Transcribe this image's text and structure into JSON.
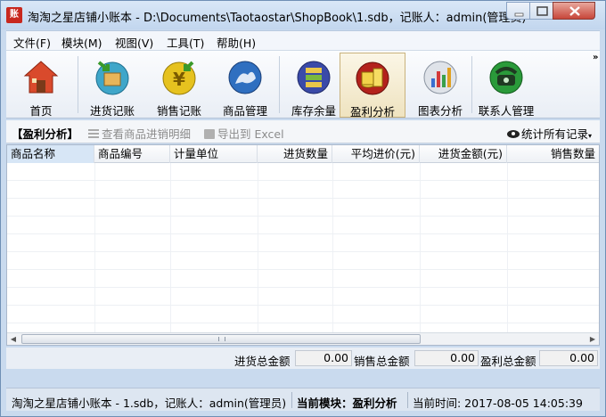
{
  "window": {
    "title": "淘淘之星店铺小账本 - D:\\Documents\\Taotaostar\\ShopBook\\1.sdb，记账人：admin(管理员)",
    "app_icon_text": "账"
  },
  "menu": {
    "items": [
      "文件(F)",
      "模块(M)",
      "视图(V)",
      "工具(T)",
      "帮助(H)"
    ]
  },
  "toolbar": {
    "overflow": "»",
    "buttons": [
      {
        "label": "首页",
        "icon": "home-icon"
      },
      {
        "label": "进货记账",
        "icon": "purchase-icon"
      },
      {
        "label": "销售记账",
        "icon": "sales-icon"
      },
      {
        "label": "商品管理",
        "icon": "goods-icon"
      },
      {
        "label": "库存余量",
        "icon": "inventory-icon"
      },
      {
        "label": "盈利分析",
        "icon": "profit-icon",
        "active": true
      },
      {
        "label": "图表分析",
        "icon": "chart-icon"
      },
      {
        "label": "联系人管理",
        "icon": "contacts-icon"
      }
    ]
  },
  "subbar": {
    "module_title": "【盈利分析】",
    "view_detail": "查看商品进销明细",
    "export_excel": "导出到 Excel",
    "stat_all": "统计所有记录"
  },
  "grid": {
    "columns": [
      "商品名称",
      "商品编号",
      "计量单位",
      "进货数量",
      "平均进价(元)",
      "进货金额(元)",
      "销售数量"
    ],
    "rows": []
  },
  "totals": {
    "purchase_label": "进货总金额",
    "purchase_value": "0.00",
    "sales_label": "销售总金额",
    "sales_value": "0.00",
    "profit_label": "盈利总金额",
    "profit_value": "0.00"
  },
  "status": {
    "file": "淘淘之星店铺小账本 - 1.sdb，记账人：admin(管理员)",
    "module": "当前模块：盈利分析",
    "time": "当前时间: 2017-08-05 14:05:39"
  },
  "colors": {
    "accent": "#c9daee",
    "close_button": "#c7463a",
    "active_tool": "#efe3c0"
  }
}
